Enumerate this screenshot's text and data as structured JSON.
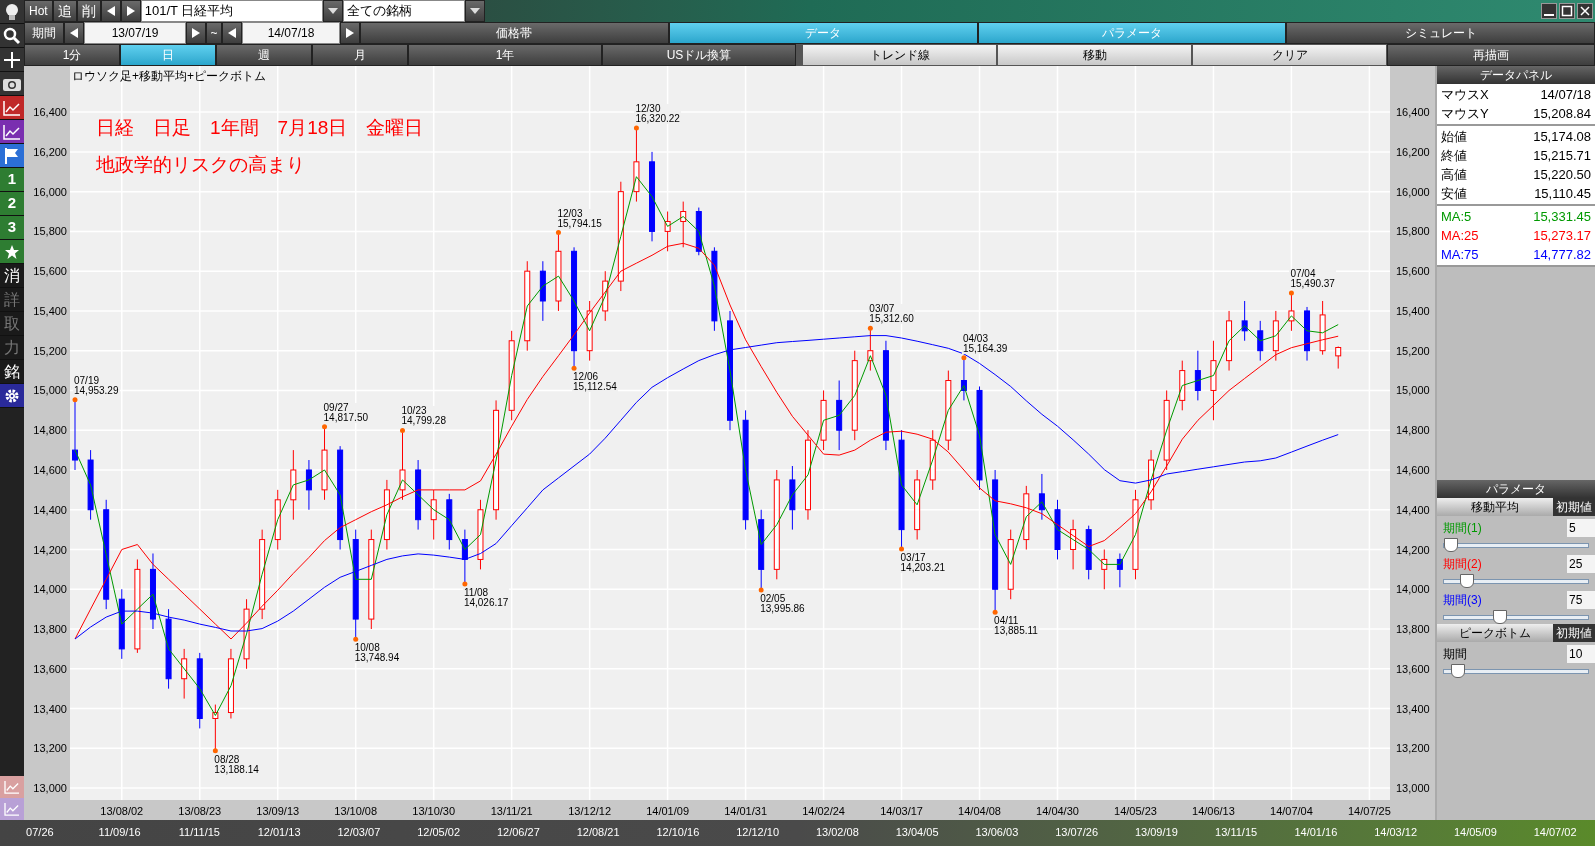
{
  "left_toolbar": [
    {
      "kind": "bulb"
    },
    {
      "kind": "search"
    },
    {
      "kind": "plus"
    },
    {
      "kind": "camera"
    },
    {
      "kind": "redchart"
    },
    {
      "kind": "purplechart"
    },
    {
      "kind": "flag"
    },
    {
      "kind": "number",
      "label": "1"
    },
    {
      "kind": "number",
      "label": "2"
    },
    {
      "kind": "number",
      "label": "3"
    },
    {
      "kind": "star"
    },
    {
      "kind": "glyph",
      "label": "消",
      "disabled": false
    },
    {
      "kind": "glyph",
      "label": "詳",
      "disabled": true
    },
    {
      "kind": "glyph",
      "label": "取",
      "disabled": true
    },
    {
      "kind": "glyph",
      "label": "力",
      "disabled": true
    },
    {
      "kind": "glyph",
      "label": "銘",
      "disabled": false
    },
    {
      "kind": "gear"
    }
  ],
  "top_bar": {
    "hot": "Hot",
    "add": "追",
    "delete": "削",
    "symbol": "101/T 日経平均",
    "group": "全ての銘柄"
  },
  "period_bar": {
    "label": "期間",
    "from": "13/07/19",
    "tilde": "~",
    "to": "14/07/18",
    "tabs": [
      {
        "label": "価格帯",
        "selected": false
      },
      {
        "label": "データ",
        "selected": true
      },
      {
        "label": "パラメータ",
        "selected": true
      },
      {
        "label": "シミュレート",
        "selected": false
      }
    ]
  },
  "interval_bar": {
    "intervals": [
      {
        "label": "1分",
        "selected": false
      },
      {
        "label": "日",
        "selected": true
      },
      {
        "label": "週",
        "selected": false
      },
      {
        "label": "月",
        "selected": false
      },
      {
        "label": "1年",
        "selected": false
      },
      {
        "label": "USドル換算",
        "selected": false
      }
    ],
    "tools": [
      "トレンド線",
      "移動",
      "クリア"
    ],
    "redraw": "再描画"
  },
  "chart": {
    "title": "ロウソク足+移動平均+ピークボトム",
    "notes": [
      "日経　日足　1年間　7月18日　金曜日",
      "地政学的リスクの高まり"
    ],
    "chart_data": {
      "type": "candlestick",
      "grid": true,
      "categories": [
        null,
        null,
        null,
        "13/08/02",
        null,
        null,
        null,
        null,
        "13/08/23",
        null,
        null,
        null,
        null,
        "13/09/13",
        null,
        null,
        null,
        null,
        "13/10/08",
        null,
        null,
        null,
        null,
        "13/10/30",
        null,
        null,
        null,
        null,
        "13/11/21",
        null,
        null,
        null,
        null,
        "13/12/12",
        null,
        null,
        null,
        null,
        "14/01/09",
        null,
        null,
        null,
        null,
        "14/01/31",
        null,
        null,
        null,
        null,
        "14/02/24",
        null,
        null,
        null,
        null,
        "14/03/17",
        null,
        null,
        null,
        null,
        "14/04/08",
        null,
        null,
        null,
        null,
        "14/04/30",
        null,
        null,
        null,
        null,
        "14/05/23",
        null,
        null,
        null,
        null,
        "14/06/13",
        null,
        null,
        null,
        null,
        "14/07/04",
        null,
        null,
        null,
        null,
        "14/07/25"
      ],
      "ohlc": [
        [
          14700,
          14953,
          14600,
          14650
        ],
        [
          14650,
          14700,
          14350,
          14400
        ],
        [
          14400,
          14450,
          13900,
          13950
        ],
        [
          13950,
          14000,
          13650,
          13700
        ],
        [
          13700,
          14150,
          13680,
          14100
        ],
        [
          14100,
          14180,
          13800,
          13850
        ],
        [
          13850,
          13900,
          13500,
          13550
        ],
        [
          13550,
          13700,
          13450,
          13650
        ],
        [
          13650,
          13680,
          13300,
          13350
        ],
        [
          13350,
          13420,
          13188,
          13380
        ],
        [
          13380,
          13700,
          13350,
          13650
        ],
        [
          13650,
          13950,
          13600,
          13900
        ],
        [
          13900,
          14300,
          13850,
          14250
        ],
        [
          14250,
          14500,
          14200,
          14450
        ],
        [
          14450,
          14700,
          14350,
          14600
        ],
        [
          14600,
          14650,
          14400,
          14500
        ],
        [
          14500,
          14817,
          14450,
          14700
        ],
        [
          14700,
          14720,
          14200,
          14250
        ],
        [
          14250,
          14300,
          13749,
          13850
        ],
        [
          13850,
          14300,
          13800,
          14250
        ],
        [
          14250,
          14550,
          14200,
          14500
        ],
        [
          14500,
          14799,
          14450,
          14600
        ],
        [
          14600,
          14650,
          14300,
          14350
        ],
        [
          14350,
          14500,
          14250,
          14450
        ],
        [
          14450,
          14480,
          14200,
          14250
        ],
        [
          14250,
          14300,
          14026,
          14150
        ],
        [
          14150,
          14450,
          14100,
          14400
        ],
        [
          14400,
          14950,
          14350,
          14900
        ],
        [
          14900,
          15300,
          14850,
          15250
        ],
        [
          15250,
          15650,
          15200,
          15600
        ],
        [
          15600,
          15650,
          15350,
          15450
        ],
        [
          15450,
          15794,
          15400,
          15700
        ],
        [
          15700,
          15720,
          15112,
          15200
        ],
        [
          15200,
          15450,
          15150,
          15400
        ],
        [
          15400,
          15600,
          15350,
          15550
        ],
        [
          15550,
          16050,
          15500,
          16000
        ],
        [
          16000,
          16320,
          15950,
          16150
        ],
        [
          16150,
          16200,
          15750,
          15800
        ],
        [
          15800,
          15900,
          15700,
          15850
        ],
        [
          15850,
          15950,
          15720,
          15900
        ],
        [
          15900,
          15920,
          15680,
          15700
        ],
        [
          15700,
          15720,
          15300,
          15350
        ],
        [
          15350,
          15400,
          14800,
          14850
        ],
        [
          14850,
          14900,
          14300,
          14350
        ],
        [
          14350,
          14400,
          13996,
          14100
        ],
        [
          14100,
          14600,
          14050,
          14550
        ],
        [
          14550,
          14620,
          14300,
          14400
        ],
        [
          14400,
          14800,
          14350,
          14750
        ],
        [
          14750,
          15000,
          14700,
          14950
        ],
        [
          14950,
          15050,
          14700,
          14800
        ],
        [
          14800,
          15200,
          14750,
          15150
        ],
        [
          15150,
          15313,
          15100,
          15200
        ],
        [
          15200,
          15250,
          14700,
          14750
        ],
        [
          14750,
          14800,
          14203,
          14300
        ],
        [
          14300,
          14600,
          14250,
          14550
        ],
        [
          14550,
          14800,
          14500,
          14750
        ],
        [
          14750,
          15100,
          14700,
          15050
        ],
        [
          15050,
          15164,
          14950,
          15000
        ],
        [
          15000,
          15020,
          14500,
          14550
        ],
        [
          14550,
          14600,
          13885,
          14000
        ],
        [
          14000,
          14300,
          13950,
          14250
        ],
        [
          14250,
          14520,
          14200,
          14480
        ],
        [
          14480,
          14580,
          14350,
          14400
        ],
        [
          14400,
          14450,
          14150,
          14200
        ],
        [
          14200,
          14350,
          14100,
          14300
        ],
        [
          14300,
          14320,
          14050,
          14100
        ],
        [
          14100,
          14200,
          14000,
          14150
        ],
        [
          14150,
          14180,
          14010,
          14100
        ],
        [
          14100,
          14500,
          14050,
          14450
        ],
        [
          14450,
          14700,
          14400,
          14650
        ],
        [
          14650,
          15000,
          14600,
          14950
        ],
        [
          14950,
          15150,
          14900,
          15100
        ],
        [
          15100,
          15200,
          14950,
          15000
        ],
        [
          15000,
          15250,
          14850,
          15150
        ],
        [
          15150,
          15400,
          15100,
          15350
        ],
        [
          15350,
          15450,
          15250,
          15300
        ],
        [
          15300,
          15350,
          15150,
          15200
        ],
        [
          15200,
          15400,
          15150,
          15350
        ],
        [
          15350,
          15490,
          15300,
          15400
        ],
        [
          15400,
          15420,
          15150,
          15200
        ],
        [
          15200,
          15450,
          15180,
          15380
        ],
        [
          15174,
          15221,
          15110,
          15216
        ],
        null,
        null
      ],
      "ylim": [
        12940,
        16632
      ],
      "yticks": [
        {
          "value": 13000,
          "label": "13,000"
        },
        {
          "value": 13200,
          "label": "13,200"
        },
        {
          "value": 13400,
          "label": "13,400"
        },
        {
          "value": 13600,
          "label": "13,600"
        },
        {
          "value": 13800,
          "label": "13,800"
        },
        {
          "value": 14000,
          "label": "14,000"
        },
        {
          "value": 14200,
          "label": "14,200"
        },
        {
          "value": 14400,
          "label": "14,400"
        },
        {
          "value": 14600,
          "label": "14,600"
        },
        {
          "value": 14800,
          "label": "14,800"
        },
        {
          "value": 15000,
          "label": "15,000"
        },
        {
          "value": 15200,
          "label": "15,200"
        },
        {
          "value": 15400,
          "label": "15,400"
        },
        {
          "value": 15600,
          "label": "15,600"
        },
        {
          "value": 15800,
          "label": "15,800"
        },
        {
          "value": 16000,
          "label": "16,000"
        },
        {
          "value": 16200,
          "label": "16,200"
        },
        {
          "value": 16400,
          "label": "16,400"
        }
      ],
      "annotations": [
        "07/19\n14,953.29",
        "08/28\n13,188.14",
        "09/27\n14,817.50",
        "10/08\n13,748.94",
        "10/23\n14,799.28",
        "11/08\n14,026.17",
        "12/03\n15,794.15",
        "12/06\n15,112.54",
        "12/30\n16,320.22",
        "02/05\n13,995.86",
        "03/07\n15,312.60",
        "03/17\n14,203.21",
        "04/03\n15,164.39",
        "04/11\n13,885.11",
        "07/04\n15,490.37"
      ]
    },
    "moving_averages": {
      "chart_data": {
        "type": "line",
        "ylim": [
          12940,
          16632
        ],
        "yticks": [
          {
            "value": 13000,
            "label": "13,000"
          },
          {
            "value": 13200,
            "label": "13,200"
          },
          {
            "value": 13400,
            "label": "13,400"
          },
          {
            "value": 13600,
            "label": "13,600"
          },
          {
            "value": 13800,
            "label": "13,800"
          },
          {
            "value": 14000,
            "label": "14,000"
          },
          {
            "value": 14200,
            "label": "14,200"
          },
          {
            "value": 14400,
            "label": "14,400"
          },
          {
            "value": 14600,
            "label": "14,600"
          },
          {
            "value": 14800,
            "label": "14,800"
          },
          {
            "value": 15000,
            "label": "15,000"
          },
          {
            "value": 15200,
            "label": "15,200"
          },
          {
            "value": 15400,
            "label": "15,400"
          },
          {
            "value": 15600,
            "label": "15,600"
          },
          {
            "value": 15800,
            "label": "15,800"
          },
          {
            "value": 16000,
            "label": "16,000"
          },
          {
            "value": 16200,
            "label": "16,200"
          },
          {
            "value": 16400,
            "label": "16,400"
          }
        ],
        "series": [
          {
            "color": "#009900",
            "values": [
              14700,
              14525,
              14175,
              13825,
              13900,
              13975,
              13700,
              13600,
              13500,
              13365,
              13515,
              13775,
              14075,
              14350,
              14525,
              14550,
              14600,
              14475,
              14050,
              14050,
              14375,
              14550,
              14475,
              14400,
              14350,
              14200,
              14275,
              14650,
              15075,
              15425,
              15525,
              15575,
              15450,
              15300,
              15475,
              15775,
              16075,
              15975,
              15825,
              15875,
              15800,
              15525,
              15100,
              14600,
              14225,
              14325,
              14475,
              14575,
              14850,
              14875,
              14975,
              15175,
              14975,
              14525,
              14425,
              14650,
              14900,
              15025,
              14775,
              14275,
              14125,
              14365,
              14440,
              14300,
              14250,
              14200,
              14125,
              14125,
              14275,
              14550,
              14800,
              15025,
              15050,
              15075,
              15250,
              15325,
              15250,
              15275,
              15375,
              15300,
              15290,
              15331,
              null,
              null
            ]
          },
          {
            "color": "#ff0000",
            "values": [
              13750,
              13900,
              14050,
              14200,
              14225,
              14125,
              14050,
              13975,
              13900,
              13825,
              13750,
              13830,
              13915,
              13995,
              14080,
              14160,
              14245,
              14310,
              14350,
              14390,
              14425,
              14465,
              14500,
              14500,
              14500,
              14500,
              14545,
              14680,
              14820,
              14955,
              15070,
              15175,
              15280,
              15390,
              15495,
              15600,
              15640,
              15680,
              15725,
              15740,
              15715,
              15630,
              15430,
              15255,
              15120,
              14990,
              14870,
              14775,
              14680,
              14675,
              14700,
              14750,
              14790,
              14795,
              14780,
              14755,
              14690,
              14600,
              14510,
              14445,
              14430,
              14410,
              14380,
              14325,
              14270,
              14215,
              14245,
              14310,
              14380,
              14490,
              14620,
              14755,
              14850,
              14925,
              15000,
              15060,
              15120,
              15180,
              15215,
              15235,
              15255,
              15273,
              null,
              null
            ]
          },
          {
            "color": "#0000ff",
            "values": [
              13750,
              13810,
              13860,
              13890,
              13890,
              13880,
              13860,
              13845,
              13825,
              13808,
              13790,
              13790,
              13802,
              13840,
              13890,
              13950,
              14010,
              14060,
              14090,
              14120,
              14150,
              14168,
              14178,
              14172,
              14162,
              14150,
              14180,
              14230,
              14320,
              14410,
              14500,
              14560,
              14620,
              14680,
              14760,
              14850,
              14940,
              15016,
              15064,
              15108,
              15150,
              15180,
              15204,
              15216,
              15228,
              15240,
              15246,
              15252,
              15258,
              15264,
              15270,
              15276,
              15276,
              15264,
              15248,
              15230,
              15212,
              15184,
              15136,
              15080,
              15020,
              14948,
              14880,
              14820,
              14752,
              14680,
              14602,
              14546,
              14534,
              14550,
              14580,
              14592,
              14604,
              14616,
              14628,
              14640,
              14646,
              14660,
              14690,
              14720,
              14750,
              14778,
              null,
              null
            ]
          }
        ]
      }
    }
  },
  "data_panel": {
    "title": "データパネル",
    "groups": [
      [
        {
          "label": "マウスX",
          "value": "14/07/18"
        },
        {
          "label": "マウスY",
          "value": "15,208.84"
        }
      ],
      [
        {
          "label": "始値",
          "value": "15,174.08"
        },
        {
          "label": "終値",
          "value": "15,215.71"
        },
        {
          "label": "高値",
          "value": "15,220.50"
        },
        {
          "label": "安値",
          "value": "15,110.45"
        }
      ],
      [
        {
          "label": "MA:5",
          "value": "15,331.45",
          "color": "#009900"
        },
        {
          "label": "MA:25",
          "value": "15,273.17",
          "color": "#ff0000"
        },
        {
          "label": "MA:75",
          "value": "14,777.82",
          "color": "#0000ff"
        }
      ]
    ]
  },
  "parameters": {
    "title": "パラメータ",
    "sections": [
      {
        "title": "移動平均",
        "reset": "初期値",
        "params": [
          {
            "label": "期間",
            "suffix": "(1)",
            "color": "#009900",
            "value": "5",
            "level": 0.0
          },
          {
            "label": "期間",
            "suffix": "(2)",
            "color": "#ff0000",
            "value": "25",
            "level": 0.12
          },
          {
            "label": "期間",
            "suffix": "(3)",
            "color": "#0000ff",
            "value": "75",
            "level": 0.38
          }
        ]
      },
      {
        "title": "ピークボトム",
        "reset": "初期値",
        "params": [
          {
            "label": "期間",
            "value": "10",
            "level": 0.05
          }
        ]
      }
    ]
  },
  "timeline": [
    "07/26",
    "11/09/16",
    "11/11/15",
    "12/01/13",
    "12/03/07",
    "12/05/02",
    "12/06/27",
    "12/08/21",
    "12/10/16",
    "12/12/10",
    "13/02/08",
    "13/04/05",
    "13/06/03",
    "13/07/26",
    "13/09/19",
    "13/11/15",
    "14/01/16",
    "14/03/12",
    "14/05/09",
    "14/07/02"
  ]
}
